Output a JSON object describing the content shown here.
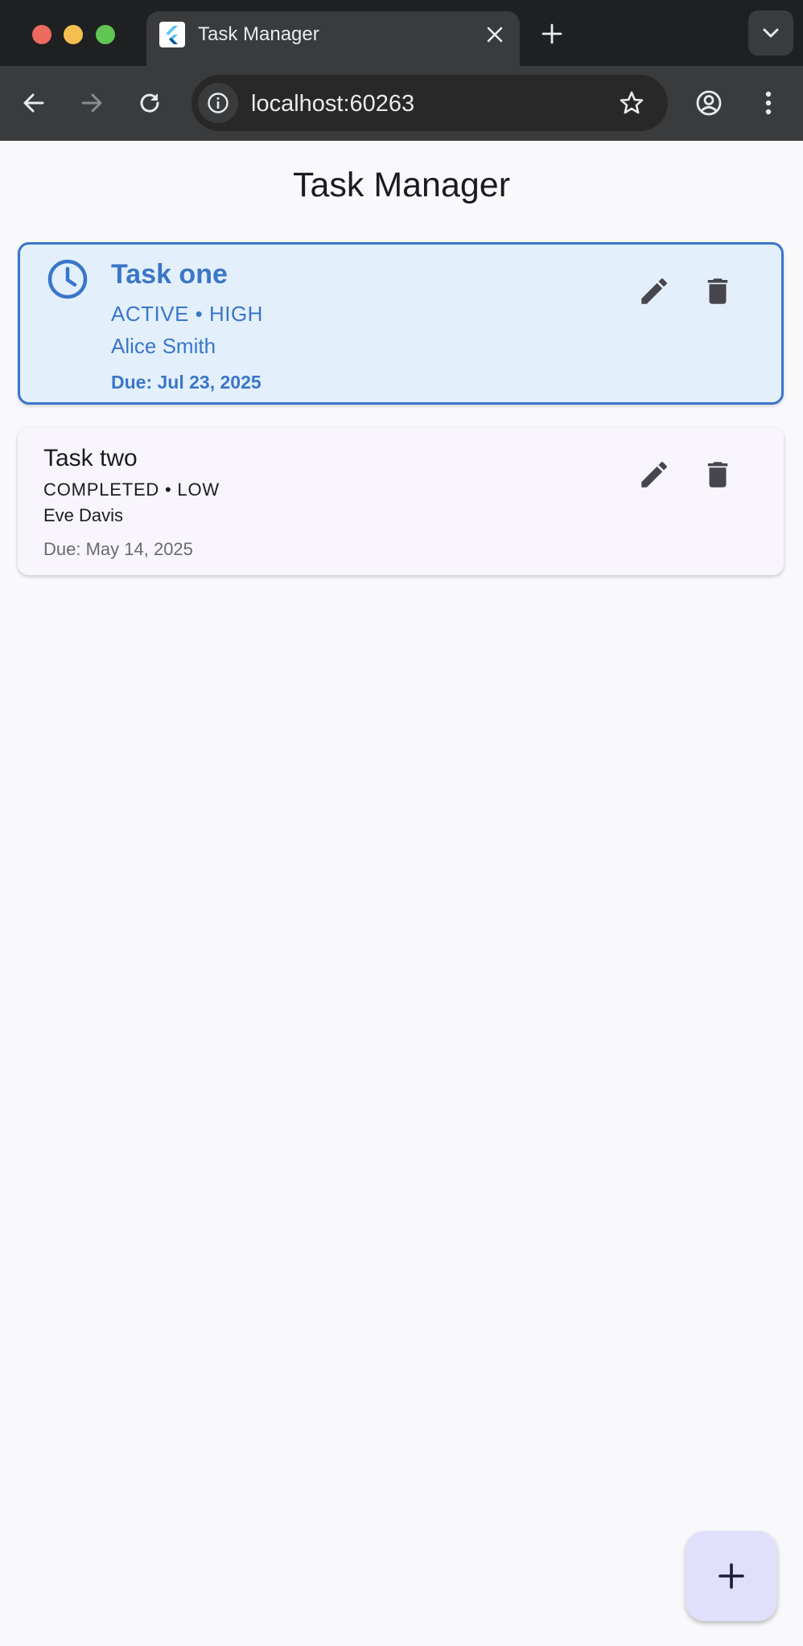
{
  "browser": {
    "tab_title": "Task Manager",
    "url": "localhost:60263",
    "icons": {
      "favicon": "flutter-logo-icon",
      "tab_close": "close-icon",
      "new_tab": "plus-icon",
      "tab_menu": "chevron-down-icon",
      "back": "arrow-left-icon",
      "forward": "arrow-right-icon",
      "reload": "reload-icon",
      "site_info": "info-icon",
      "bookmark": "star-icon",
      "profile": "account-icon",
      "menu": "more-vert-icon"
    }
  },
  "app": {
    "title": "Task Manager",
    "accent_color": "#3a76c9",
    "tasks": [
      {
        "title": "Task one",
        "status_line": "ACTIVE • HIGH",
        "assignee": "Alice Smith",
        "due": "Due: Jul 23, 2025",
        "selected": true,
        "icon": "clock-icon"
      },
      {
        "title": "Task two",
        "status_line": "COMPLETED • LOW",
        "assignee": "Eve Davis",
        "due": "Due: May 14, 2025",
        "selected": false
      }
    ],
    "fab_icon": "plus-icon"
  }
}
